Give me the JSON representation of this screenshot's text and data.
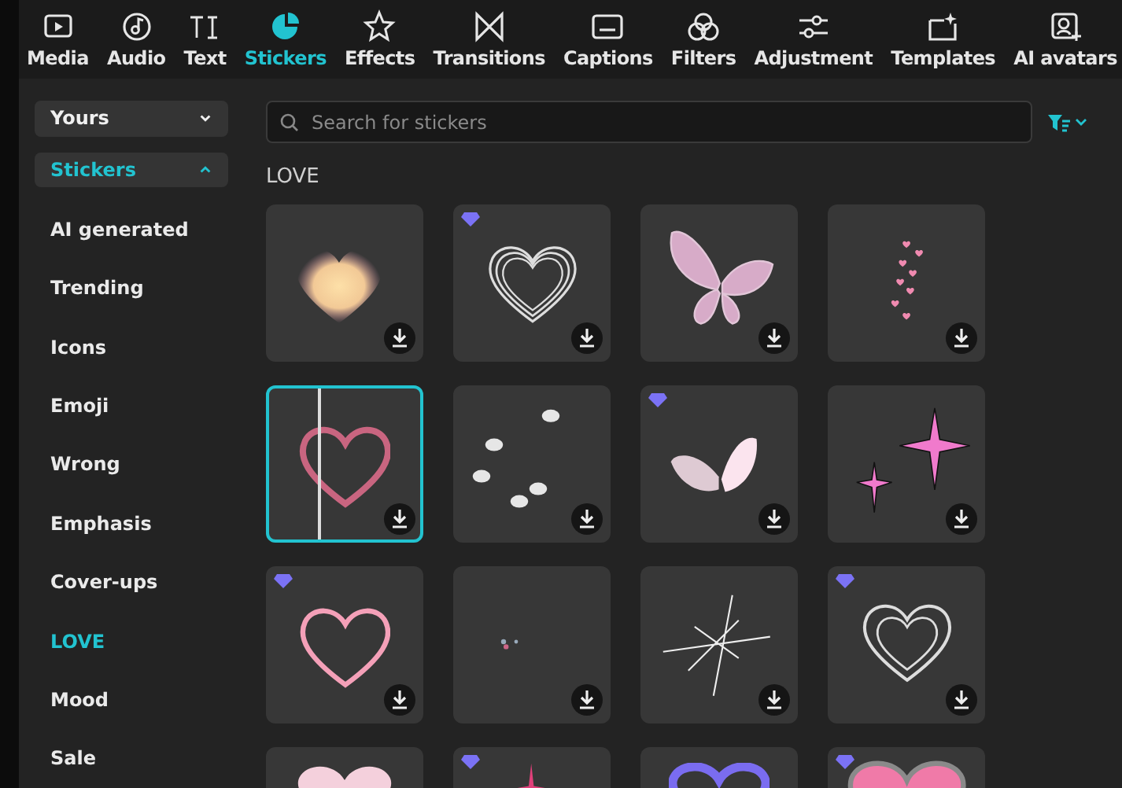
{
  "toolbar": {
    "tabs": [
      {
        "label": "Media",
        "selected": false
      },
      {
        "label": "Audio",
        "selected": false
      },
      {
        "label": "Text",
        "selected": false
      },
      {
        "label": "Stickers",
        "selected": true
      },
      {
        "label": "Effects",
        "selected": false
      },
      {
        "label": "Transitions",
        "selected": false
      },
      {
        "label": "Captions",
        "selected": false
      },
      {
        "label": "Filters",
        "selected": false
      },
      {
        "label": "Adjustment",
        "selected": false
      },
      {
        "label": "Templates",
        "selected": false
      },
      {
        "label": "AI avatars",
        "selected": false
      }
    ]
  },
  "sidebar": {
    "sections": [
      {
        "label": "Yours",
        "expanded": false
      },
      {
        "label": "Stickers",
        "expanded": true
      }
    ],
    "items": [
      {
        "label": "AI generated",
        "selected": false
      },
      {
        "label": "Trending",
        "selected": false
      },
      {
        "label": "Icons",
        "selected": false
      },
      {
        "label": "Emoji",
        "selected": false
      },
      {
        "label": "Wrong",
        "selected": false
      },
      {
        "label": "Emphasis",
        "selected": false
      },
      {
        "label": "Cover-ups",
        "selected": false
      },
      {
        "label": "LOVE",
        "selected": true
      },
      {
        "label": "Mood",
        "selected": false
      },
      {
        "label": "Sale",
        "selected": false
      }
    ]
  },
  "search": {
    "placeholder": "Search for stickers"
  },
  "section_title": "LOVE",
  "stickers": [
    {
      "kind": "glow-heart",
      "premium": false,
      "selected": false
    },
    {
      "kind": "outline-hearts",
      "premium": true,
      "selected": false
    },
    {
      "kind": "butterfly",
      "premium": false,
      "selected": false
    },
    {
      "kind": "small-hearts",
      "premium": false,
      "selected": false
    },
    {
      "kind": "neon-heart",
      "premium": false,
      "selected": true
    },
    {
      "kind": "butterflies",
      "premium": false,
      "selected": false
    },
    {
      "kind": "soft-butterfly",
      "premium": true,
      "selected": false
    },
    {
      "kind": "sparkles",
      "premium": false,
      "selected": false
    },
    {
      "kind": "pink-heart",
      "premium": true,
      "selected": false
    },
    {
      "kind": "specks",
      "premium": false,
      "selected": false
    },
    {
      "kind": "starburst",
      "premium": false,
      "selected": false
    },
    {
      "kind": "chalk-hearts",
      "premium": true,
      "selected": false
    },
    {
      "kind": "white-heart",
      "premium": false,
      "selected": false
    },
    {
      "kind": "pink-star",
      "premium": true,
      "selected": false
    },
    {
      "kind": "purple-heart",
      "premium": false,
      "selected": false
    },
    {
      "kind": "big-heart",
      "premium": true,
      "selected": false
    }
  ]
}
